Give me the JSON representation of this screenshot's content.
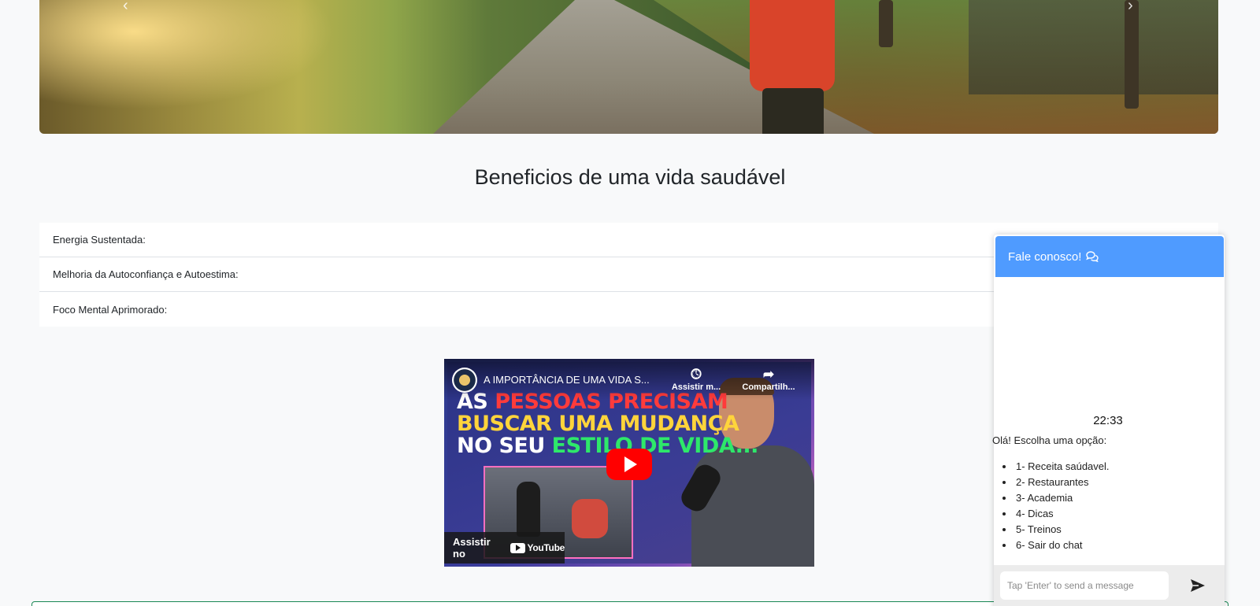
{
  "hero": {
    "prev_control": "‹",
    "next_control": "›"
  },
  "benefits": {
    "title": "Beneficios de uma vida saudável",
    "items": [
      {
        "label": "Energia Sustentada:"
      },
      {
        "label": "Melhoria da Autoconfiança e Autoestima:"
      },
      {
        "label": "Foco Mental Aprimorado:"
      }
    ]
  },
  "video": {
    "title": "A IMPORTÂNCIA DE UMA VIDA S...",
    "watch_later": "Assistir m...",
    "share": "Compartilh...",
    "headline_line1_a": "AS ",
    "headline_line1_b": "PESSOAS PRECISAM",
    "headline_line2": "BUSCAR UMA MUDANÇA",
    "headline_line3_a": "NO SEU ",
    "headline_line3_b": "ESTILO DE VIDA...",
    "watch_on": "Assistir no",
    "youtube": "YouTube"
  },
  "chat": {
    "header": "Fale conosco!",
    "time": "22:33",
    "greeting": "Olá! Escolha uma opção:",
    "options": [
      "1- Receita saúdavel.",
      "2- Restaurantes",
      "3- Academia",
      "4- Dicas",
      "5- Treinos",
      "6- Sair do chat"
    ],
    "input_placeholder": "Tap 'Enter' to send a message"
  },
  "colors": {
    "chat_header": "#4f9bff",
    "youtube_red": "#ff0000",
    "footer_border": "#198754"
  }
}
